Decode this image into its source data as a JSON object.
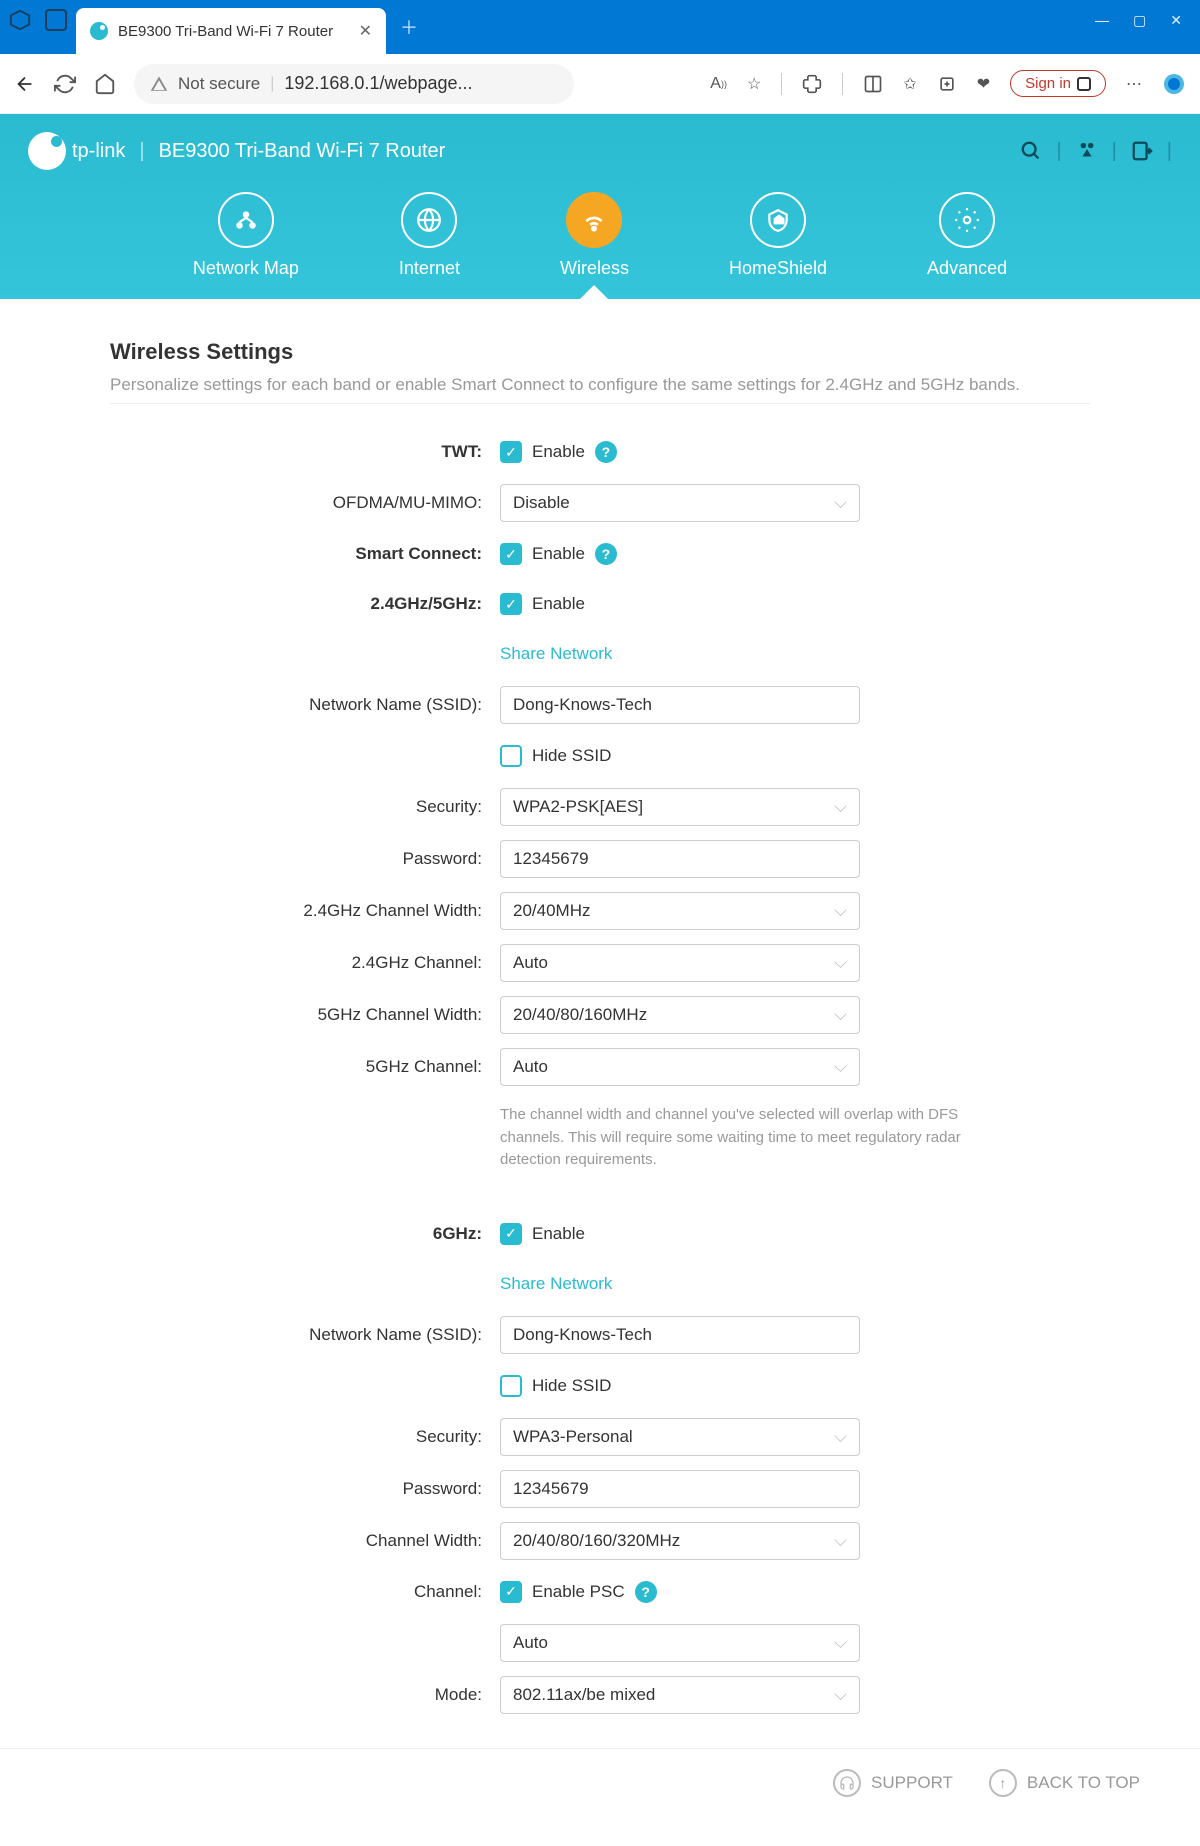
{
  "browser": {
    "tab_title": "BE9300 Tri-Band Wi-Fi 7 Router",
    "not_secure": "Not secure",
    "url": "192.168.0.1/webpage...",
    "signin": "Sign in"
  },
  "header": {
    "brand": "tp-link",
    "device": "BE9300 Tri-Band Wi-Fi 7 Router"
  },
  "nav": {
    "network_map": "Network Map",
    "internet": "Internet",
    "wireless": "Wireless",
    "homeshield": "HomeShield",
    "advanced": "Advanced"
  },
  "page": {
    "title": "Wireless Settings",
    "desc": "Personalize settings for each band or enable Smart Connect to configure the same settings for 2.4GHz and 5GHz bands."
  },
  "labels": {
    "twt": "TWT:",
    "ofdma": "OFDMA/MU-MIMO:",
    "smart_connect": "Smart Connect:",
    "band_24_5": "2.4GHz/5GHz:",
    "ssid": "Network Name (SSID):",
    "security": "Security:",
    "password": "Password:",
    "ch_width_24": "2.4GHz Channel Width:",
    "ch_24": "2.4GHz Channel:",
    "ch_width_5": "5GHz Channel Width:",
    "ch_5": "5GHz Channel:",
    "band_6": "6GHz:",
    "ch_width": "Channel Width:",
    "channel": "Channel:",
    "mode": "Mode:",
    "enable": "Enable",
    "enable_psc": "Enable PSC",
    "hide_ssid": "Hide SSID",
    "share_network": "Share Network"
  },
  "values": {
    "ofdma": "Disable",
    "ssid_1": "Dong-Knows-Tech",
    "security_1": "WPA2-PSK[AES]",
    "password_1": "12345679",
    "ch_width_24": "20/40MHz",
    "ch_24": "Auto",
    "ch_width_5": "20/40/80/160MHz",
    "ch_5": "Auto",
    "dfs_note": "The channel width and channel you've selected will overlap with DFS channels. This will require some waiting time to meet regulatory radar detection requirements.",
    "ssid_2": "Dong-Knows-Tech",
    "security_2": "WPA3-Personal",
    "password_2": "12345679",
    "ch_width_6": "20/40/80/160/320MHz",
    "ch_6": "Auto",
    "mode": "802.11ax/be mixed"
  },
  "footer": {
    "support": "SUPPORT",
    "back_to_top": "BACK TO TOP"
  }
}
